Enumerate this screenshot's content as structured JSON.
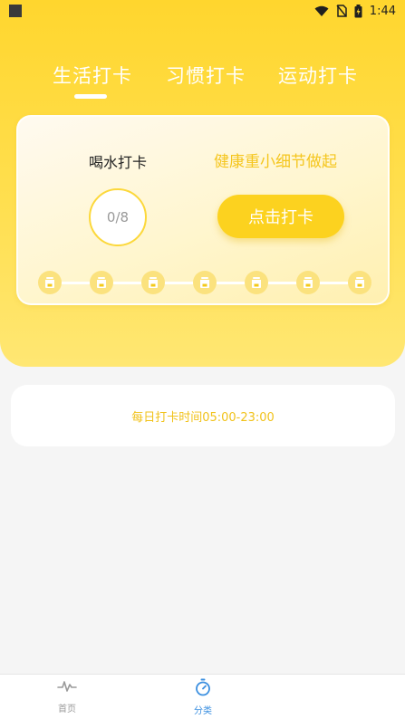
{
  "status_bar": {
    "time": "1:44"
  },
  "tabs": [
    {
      "label": "生活打卡",
      "active": true
    },
    {
      "label": "习惯打卡",
      "active": false
    },
    {
      "label": "运动打卡",
      "active": false
    }
  ],
  "card": {
    "habit_name": "喝水打卡",
    "slogan": "健康重小细节做起",
    "progress_text": "0/8",
    "progress_done": 0,
    "progress_total": 8,
    "checkin_button_label": "点击打卡",
    "timeline_icon": "cup-icon",
    "timeline_count": 7
  },
  "info": {
    "text": "每日打卡时间05:00-23:00"
  },
  "bottom_nav": [
    {
      "label": "首页",
      "icon": "pulse-icon",
      "active": false
    },
    {
      "label": "分类",
      "icon": "stopwatch-icon",
      "active": true
    }
  ],
  "colors": {
    "accent": "#fcd21f",
    "header_yellow": "#ffd62e",
    "nav_active": "#3b8fe0",
    "nav_inactive": "#9a9a9a"
  }
}
